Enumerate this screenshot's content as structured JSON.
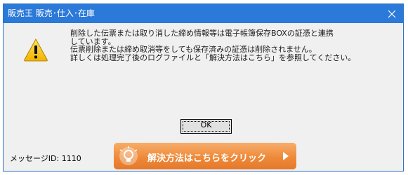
{
  "window": {
    "title": "販売王 販売･仕入･在庫"
  },
  "message": {
    "lines": [
      "削除した伝票または取り消した締め情報等は電子帳簿保存BOXの証憑と連携",
      "しています。",
      "伝票削除または締め取消等をしても保存済みの証憑は削除されません。",
      "詳しくは処理完了後のログファイルと「解決方法はこちら」を参照してください。"
    ]
  },
  "buttons": {
    "ok": "OK",
    "help": "解決方法はこちらをクリック"
  },
  "footer": {
    "message_id": "メッセージID: 1110"
  },
  "icons": {
    "close": "close-icon",
    "warning": "warning-icon",
    "help": "lightbulb-icon",
    "help_arrow": "play-arrow-icon"
  },
  "colors": {
    "titlebar": "#2b79d8",
    "help_button": "#ee8a3a",
    "warning_fill": "#f7c600"
  }
}
